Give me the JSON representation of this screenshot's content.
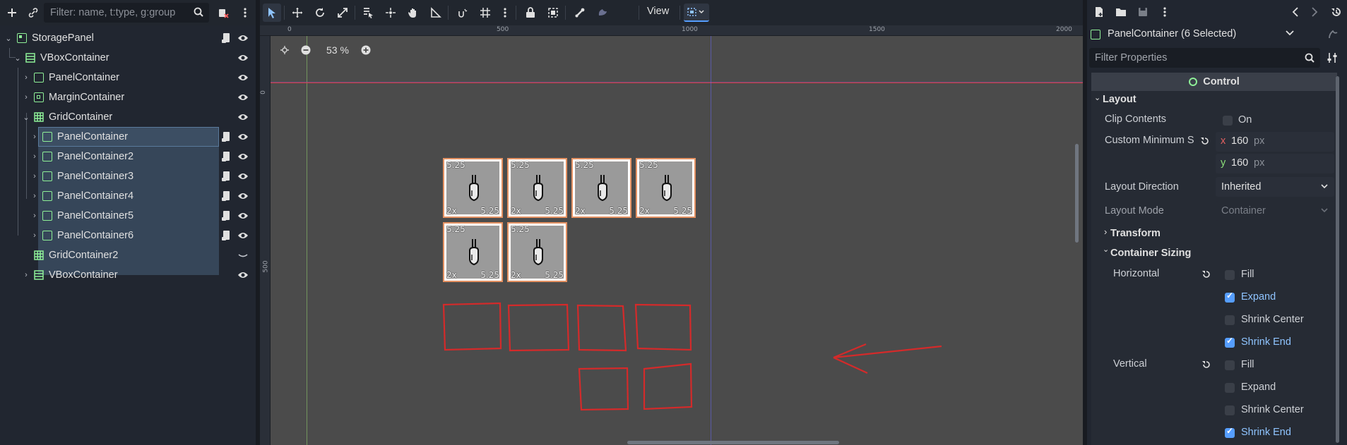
{
  "scene_dock": {
    "filter_placeholder": "Filter: name, t:type, g:group",
    "nodes": [
      {
        "label": "StoragePanel",
        "icon": "panel-icon",
        "depth": 0
      },
      {
        "label": "VBoxContainer",
        "icon": "vbox-icon",
        "depth": 1
      },
      {
        "label": "PanelContainer",
        "icon": "panel-container-icon",
        "depth": 2
      },
      {
        "label": "MarginContainer",
        "icon": "margin-container-icon",
        "depth": 2
      },
      {
        "label": "GridContainer",
        "icon": "grid-container-icon",
        "depth": 2
      },
      {
        "label": "PanelContainer",
        "icon": "panel-container-icon",
        "depth": 3
      },
      {
        "label": "PanelContainer2",
        "icon": "panel-container-icon",
        "depth": 3
      },
      {
        "label": "PanelContainer3",
        "icon": "panel-container-icon",
        "depth": 3
      },
      {
        "label": "PanelContainer4",
        "icon": "panel-container-icon",
        "depth": 3
      },
      {
        "label": "PanelContainer5",
        "icon": "panel-container-icon",
        "depth": 3
      },
      {
        "label": "PanelContainer6",
        "icon": "panel-container-icon",
        "depth": 3
      },
      {
        "label": "GridContainer2",
        "icon": "grid-container-icon",
        "depth": 2
      },
      {
        "label": "VBoxContainer",
        "icon": "vbox-icon",
        "depth": 2
      }
    ]
  },
  "canvas": {
    "view_menu": "View",
    "zoom": "53 %",
    "ruler_top": [
      "0",
      "500",
      "1000",
      "1500",
      "2000"
    ],
    "ruler_left": [
      "0",
      "500"
    ],
    "item": {
      "top": "5.25",
      "bottom_left": "2x",
      "bottom_right": "5.25"
    },
    "item_count": 6
  },
  "inspector": {
    "object_title": "PanelContainer (6 Selected)",
    "filter_placeholder": "Filter Properties",
    "class_header": "Control",
    "layout_section": "Layout",
    "clip_contents_label": "Clip Contents",
    "clip_contents_value": "On",
    "clip_contents_checked": false,
    "custom_min_size_label": "Custom Minimum S",
    "min_x_axis": "x",
    "min_x": "160",
    "min_y_axis": "y",
    "min_y": "160",
    "unit": "px",
    "layout_direction_label": "Layout Direction",
    "layout_direction_value": "Inherited",
    "layout_mode_label": "Layout Mode",
    "layout_mode_value": "Container",
    "transform_section": "Transform",
    "container_sizing_section": "Container Sizing",
    "horizontal_label": "Horizontal",
    "horizontal_options": [
      {
        "label": "Fill",
        "checked": false
      },
      {
        "label": "Expand",
        "checked": true
      },
      {
        "label": "Shrink Center",
        "checked": false
      },
      {
        "label": "Shrink End",
        "checked": true
      }
    ],
    "vertical_label": "Vertical",
    "vertical_options": [
      {
        "label": "Fill",
        "checked": false
      },
      {
        "label": "Expand",
        "checked": false
      },
      {
        "label": "Shrink Center",
        "checked": false
      },
      {
        "label": "Shrink End",
        "checked": true
      }
    ]
  },
  "colors": {
    "selection": "#364659",
    "accent": "#569eff",
    "node_green": "#8eef97",
    "annotation_red": "#d42a2a",
    "item_border": "#e59263"
  }
}
